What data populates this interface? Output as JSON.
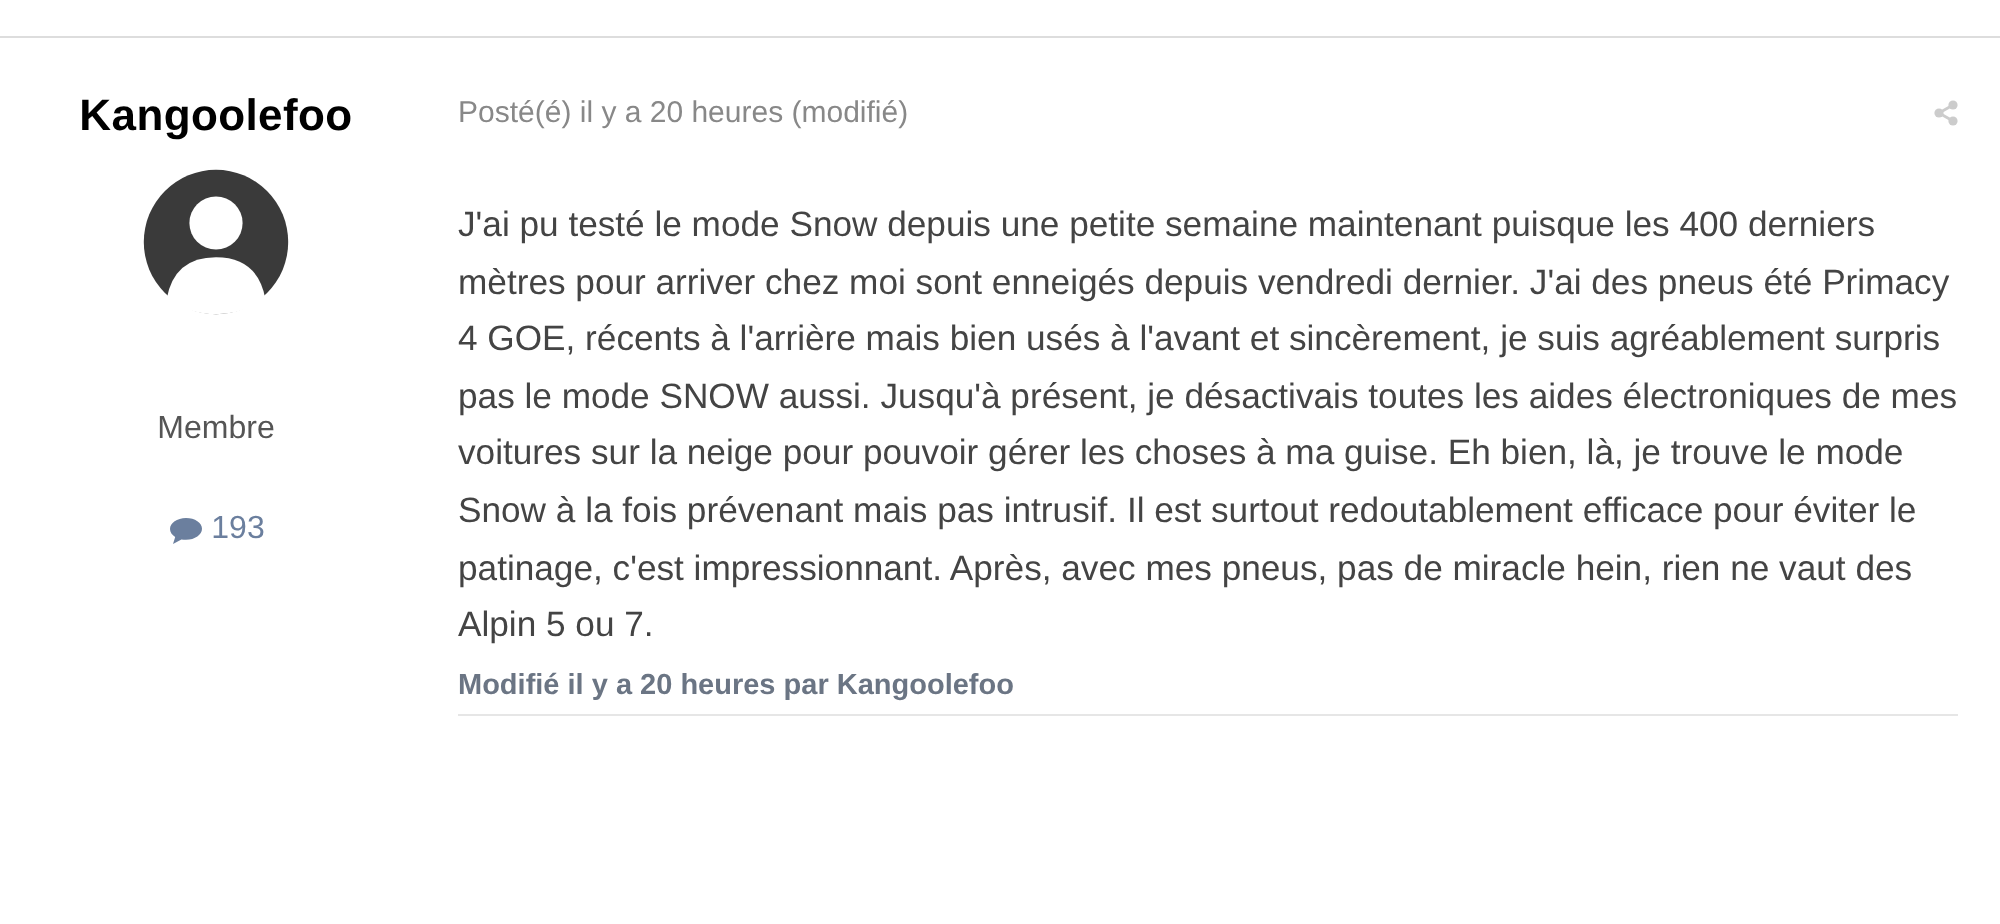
{
  "post": {
    "author": "Kangoolefoo",
    "role": "Membre",
    "post_count": "193",
    "posted": "Posté(é) il y a 20 heures (modifié)",
    "body": "J'ai pu testé le mode Snow depuis une petite semaine maintenant puisque les 400 derniers mètres pour arriver chez moi sont enneigés depuis vendredi dernier. J'ai des pneus été Primacy 4 GOE, récents à l'arrière mais bien usés à l'avant et sincèrement, je suis agréablement surpris pas le mode SNOW aussi. Jusqu'à présent, je désactivais toutes les aides électroniques de mes voitures sur la neige pour pouvoir gérer les choses à ma guise. Eh bien, là, je trouve le mode Snow à la fois prévenant mais pas intrusif. Il est surtout redoutablement efficace pour éviter le patinage, c'est impressionnant. Après, avec mes pneus, pas de miracle hein, rien ne vaut des Alpin 5 ou 7.",
    "edited_note": "Modifié il y a 20 heures par Kangoolefoo"
  }
}
